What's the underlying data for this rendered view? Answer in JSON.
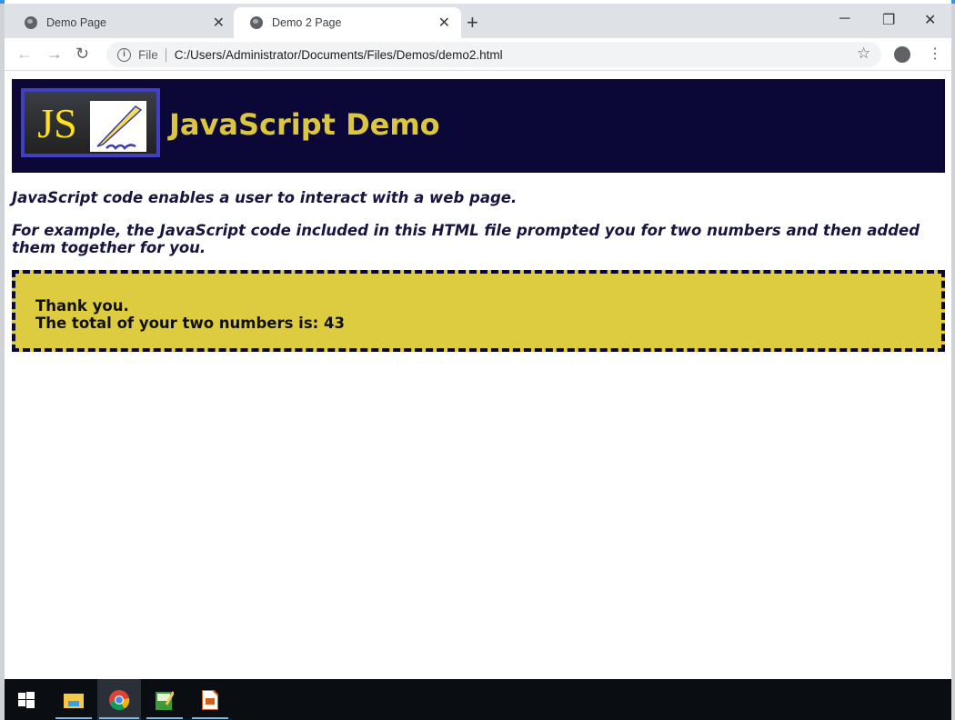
{
  "browser": {
    "tabs": [
      {
        "title": "Demo Page"
      },
      {
        "title": "Demo 2 Page"
      }
    ],
    "address_scheme": "File",
    "url": "C:/Users/Administrator/Documents/Files/Demos/demo2.html"
  },
  "page": {
    "logo_text": "JS",
    "title": "JavaScript Demo",
    "para1": "JavaScript code enables a user to interact with a web page.",
    "para2": "For example, the JavaScript code included in this HTML file prompted you for two numbers and then added them together for you.",
    "result_line1": "Thank you.",
    "result_line2": "The total of your two numbers is: 43"
  },
  "colors": {
    "header_bg": "#0b0736",
    "title": "#dcc63e",
    "result_bg": "#ddcb40"
  },
  "taskbar": {
    "apps": [
      "start-icon",
      "file-explorer-icon",
      "chrome-icon",
      "notepad-icon",
      "impress-icon"
    ]
  }
}
